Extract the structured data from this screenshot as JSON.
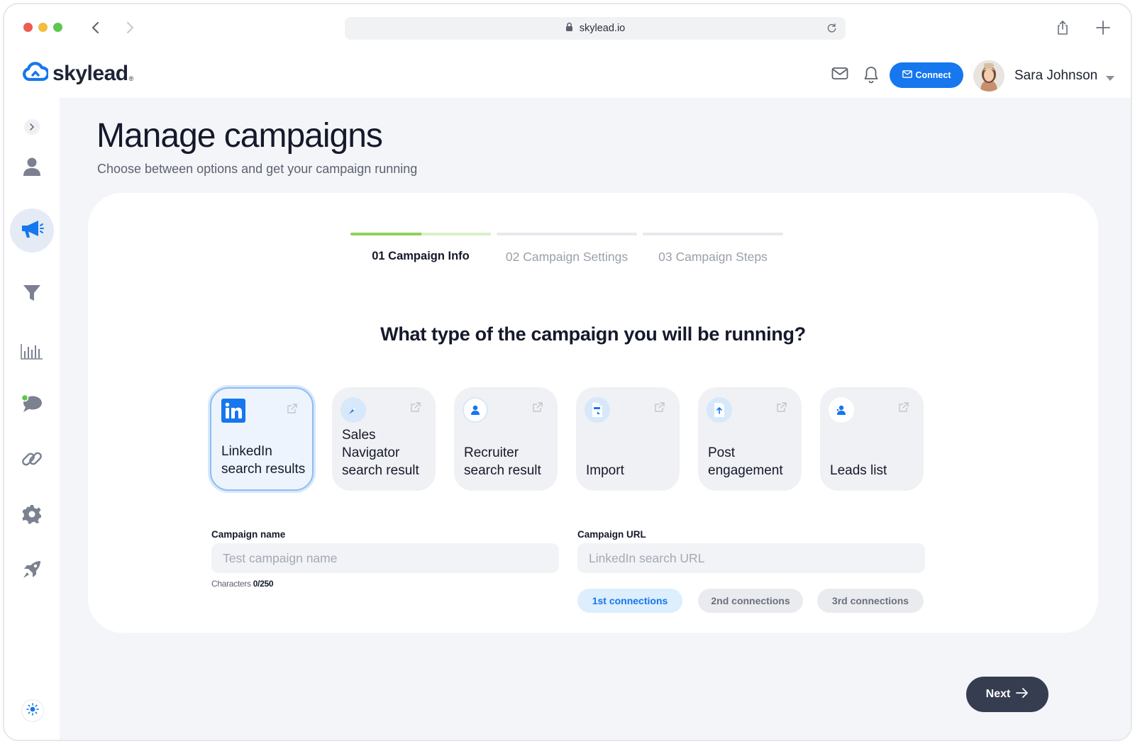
{
  "browser": {
    "url": "skylead.io"
  },
  "header": {
    "logo_text": "skylead",
    "logo_mark": "®",
    "connect_label": "Connect",
    "user_name": "Sara Johnson"
  },
  "sidebar": {
    "items": [
      {
        "icon": "user-icon",
        "active": false
      },
      {
        "icon": "megaphone-icon",
        "active": true
      },
      {
        "icon": "filter-icon",
        "active": false
      },
      {
        "icon": "bar-chart-icon",
        "active": false
      },
      {
        "icon": "chat-icon",
        "active": false
      },
      {
        "icon": "link-icon",
        "active": false
      },
      {
        "icon": "gear-icon",
        "active": false
      },
      {
        "icon": "rocket-icon",
        "active": false
      }
    ]
  },
  "page": {
    "title": "Manage campaigns",
    "subtitle": "Choose between options and get your campaign running"
  },
  "steps": [
    {
      "label": "01 Campaign Info",
      "current": true
    },
    {
      "label": "02 Campaign Settings",
      "current": false
    },
    {
      "label": "03 Campaign Steps",
      "current": false
    }
  ],
  "question": "What type of the campaign you will be running?",
  "campaign_types": [
    {
      "line1": "LinkedIn",
      "line2": "search results",
      "icon": "linkedin-icon",
      "selected": true
    },
    {
      "line1": "Sales Navigator",
      "line2": "search result",
      "icon": "compass-icon",
      "selected": false
    },
    {
      "line1": "Recruiter",
      "line2": "search result",
      "icon": "person-icon",
      "selected": false
    },
    {
      "line1": "",
      "line2": "Import",
      "icon": "csv-file-icon",
      "selected": false
    },
    {
      "line1": "Post",
      "line2": "engagement",
      "icon": "upload-file-icon",
      "selected": false
    },
    {
      "line1": "",
      "line2": "Leads list",
      "icon": "leads-icon",
      "selected": false
    }
  ],
  "form": {
    "name_label": "Campaign name",
    "name_placeholder": "Test campaign name",
    "char_prefix": "Characters",
    "char_count": "0/250",
    "url_label": "Campaign URL",
    "url_placeholder": "LinkedIn search URL",
    "connections": [
      {
        "label": "1st connections",
        "active": true
      },
      {
        "label": "2nd connections",
        "active": false
      },
      {
        "label": "3rd connections",
        "active": false
      }
    ]
  },
  "footer": {
    "next_label": "Next"
  },
  "colors": {
    "brand_blue": "#1677ee",
    "progress_green": "#8fd15e",
    "dark_button": "#363d50"
  }
}
